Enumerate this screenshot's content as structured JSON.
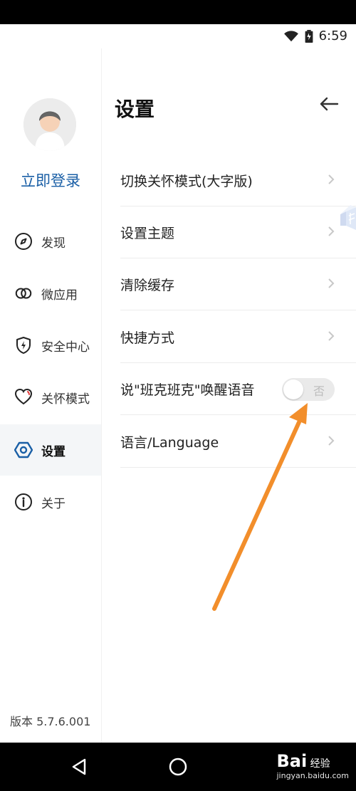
{
  "status": {
    "time": "6:59"
  },
  "sidebar": {
    "login_label": "立即登录",
    "items": [
      {
        "label": "发现"
      },
      {
        "label": "微应用"
      },
      {
        "label": "安全中心"
      },
      {
        "label": "关怀模式"
      },
      {
        "label": "设置"
      },
      {
        "label": "关于"
      }
    ],
    "version": "版本 5.7.6.001"
  },
  "page": {
    "title": "设置",
    "rows": [
      {
        "label": "切换关怀模式(大字版)"
      },
      {
        "label": "设置主题"
      },
      {
        "label": "清除缓存"
      },
      {
        "label": "快捷方式"
      },
      {
        "label": "说\"班克班克\"唤醒语音"
      },
      {
        "label": "语言/Language"
      }
    ],
    "toggle_off_label": "否"
  },
  "watermark": {
    "brand": "Bai",
    "sub": "经验",
    "url": "jingyan.baidu.com"
  },
  "colors": {
    "accent": "#1a5fa6",
    "arrow": "#f28e2b"
  }
}
